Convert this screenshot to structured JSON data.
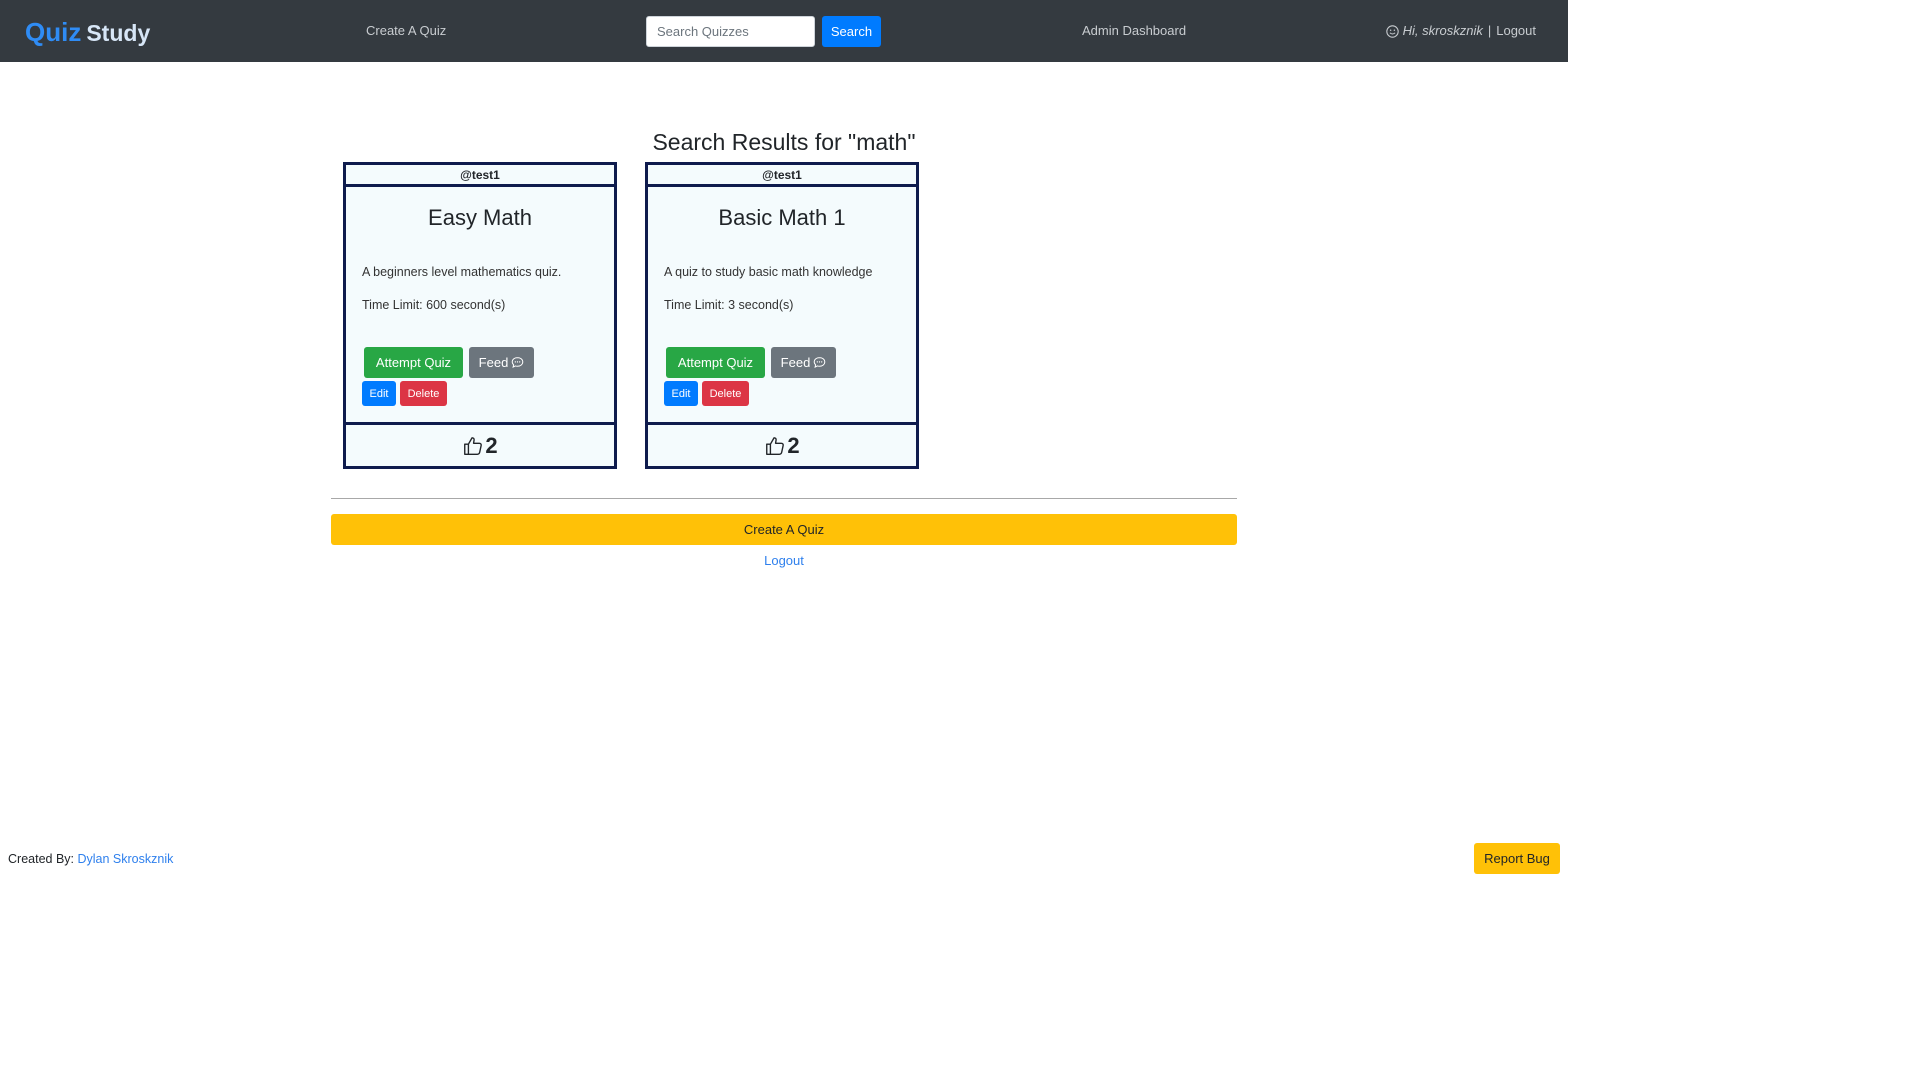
{
  "navbar": {
    "brand_quiz": "Quiz",
    "brand_study": "Study",
    "create_link": "Create A Quiz",
    "search_placeholder": "Search Quizzes",
    "search_button": "Search",
    "admin_link": "Admin Dashboard",
    "greeting": "Hi, skroskznik",
    "separator": "|",
    "logout": "Logout",
    "user_icon": "smile-icon"
  },
  "main": {
    "heading": "Search Results for \"math\"",
    "cards": [
      {
        "author": "@test1",
        "title": "Easy Math",
        "description": "A beginners level mathematics quiz.",
        "time_limit": "Time Limit: 600 second(s)",
        "attempt_label": "Attempt Quiz",
        "feed_label": "Feed",
        "edit_label": "Edit",
        "delete_label": "Delete",
        "likes": "2"
      },
      {
        "author": "@test1",
        "title": "Basic Math 1",
        "description": "A quiz to study basic math knowledge",
        "time_limit": "Time Limit: 3 second(s)",
        "attempt_label": "Attempt Quiz",
        "feed_label": "Feed",
        "edit_label": "Edit",
        "delete_label": "Delete",
        "likes": "2"
      }
    ],
    "create_button": "Create A Quiz",
    "logout_link": "Logout"
  },
  "footer": {
    "created_by": "Created By:",
    "author": "Dylan Skroskznik",
    "report_button": "Report Bug"
  },
  "colors": {
    "navbar_bg": "#343a40",
    "brand_blue": "#2f8cf5",
    "primary": "#007bff",
    "success": "#28a745",
    "secondary": "#6c757d",
    "danger": "#dc3545",
    "warning": "#ffc107",
    "card_border": "#0e1b4d"
  }
}
